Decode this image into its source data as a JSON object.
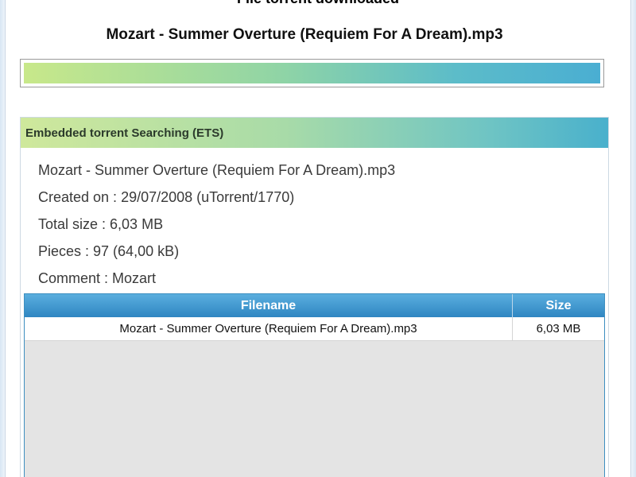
{
  "header": {
    "status_text": "File torrent downloaded",
    "file_title": "Mozart - Summer Overture (Requiem For A Dream).mp3"
  },
  "progress": {
    "percent": 100,
    "colors": [
      "#c8e88a",
      "#5cbcc9",
      "#4aaed2"
    ]
  },
  "ets_panel": {
    "title": "Embedded torrent Searching (ETS)",
    "info": {
      "name": "Mozart - Summer Overture (Requiem For A Dream).mp3",
      "created": "Created on : 29/07/2008 (uTorrent/1770)",
      "total_size": "Total size : 6,03 MB",
      "pieces": "Pieces : 97 (64,00 kB)",
      "comment": "Comment : Mozart"
    },
    "table": {
      "columns": [
        "Filename",
        "Size"
      ],
      "rows": [
        [
          "Mozart - Summer Overture (Requiem For A Dream).mp3",
          "6,03 MB"
        ]
      ]
    }
  },
  "colors": {
    "header_blue": "#2f86c2",
    "table_empty": "#e4e4e4",
    "text": "#3a3a3a"
  }
}
